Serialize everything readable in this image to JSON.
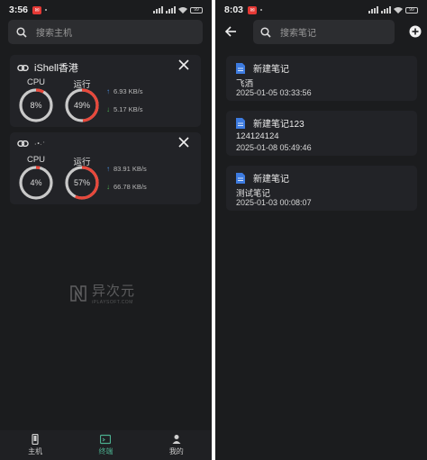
{
  "left": {
    "status": {
      "time": "3:56",
      "battery": "99"
    },
    "search": {
      "placeholder": "搜索主机"
    },
    "servers": [
      {
        "name": "iShell香港",
        "cpu_label": "CPU",
        "cpu_value": "8%",
        "cpu_percent": 8,
        "run_label": "运行",
        "run_value": "49%",
        "run_percent": 49,
        "upload": "6.93 KB/s",
        "download": "5.17 KB/s"
      },
      {
        "name": "",
        "cpu_label": "CPU",
        "cpu_value": "4%",
        "cpu_percent": 4,
        "run_label": "运行",
        "run_value": "57%",
        "run_percent": 57,
        "upload": "83.91 KB/s",
        "download": "66.78 KB/s"
      }
    ],
    "watermark": {
      "cn": "异次元",
      "en": "iPLAYSOFT.COM"
    },
    "nav": [
      {
        "label": "主机",
        "icon": "phone-icon",
        "active": false
      },
      {
        "label": "终端",
        "icon": "terminal-icon",
        "active": true
      },
      {
        "label": "我的",
        "icon": "person-icon",
        "active": false
      }
    ]
  },
  "right": {
    "status": {
      "time": "8:03",
      "battery": "99"
    },
    "search": {
      "placeholder": "搜索笔记"
    },
    "notes": [
      {
        "title": "新建笔记",
        "body": "飞洒",
        "date": "2025-01-05 03:33:56"
      },
      {
        "title": "新建笔记123",
        "body": "124124124",
        "date": "2025-01-08 05:49:46"
      },
      {
        "title": "新建笔记",
        "body": "测试笔记",
        "date": "2025-01-03 00:08:07"
      }
    ]
  },
  "colors": {
    "background": "#1b1c1e",
    "card": "#222327",
    "gauge_track": "#c9c9c9",
    "gauge_fill": "#e8483b",
    "accent_active": "#4caf8f",
    "upload_arrow": "#4a90e2",
    "download_arrow": "#4caf50",
    "doc_icon": "#3d7be0"
  }
}
